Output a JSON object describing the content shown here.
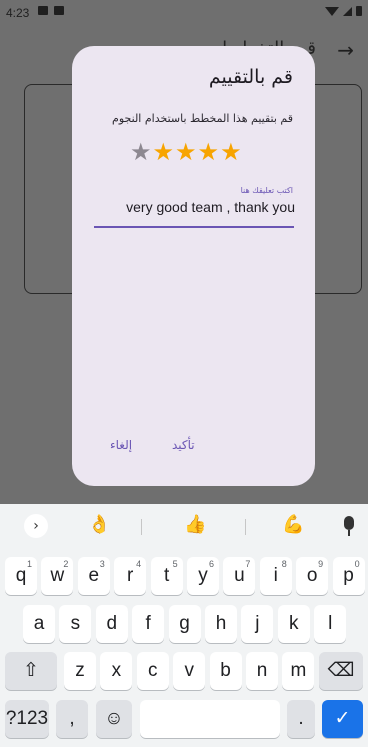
{
  "status": {
    "time": "4:23"
  },
  "background": {
    "title": "قم بالتخطيط",
    "back_arrow": "→"
  },
  "dialog": {
    "title": "قم بالتقييم",
    "subtitle": "قم بتقييم هذا المخطط باستخدام النجوم",
    "rating": {
      "value": 4,
      "max": 5,
      "on_color": "#f7a400",
      "off_color": "#8d8891"
    },
    "comment_label": "اكتب تعليقك هنا",
    "comment_value": "very good team  , thank you",
    "confirm_label": "تأكيد",
    "cancel_label": "إلغاء"
  },
  "keyboard": {
    "suggest_chevron": "›",
    "suggest_emojis": [
      "👌",
      "👍",
      "💪"
    ],
    "row1": [
      {
        "k": "q",
        "n": "1"
      },
      {
        "k": "w",
        "n": "2"
      },
      {
        "k": "e",
        "n": "3"
      },
      {
        "k": "r",
        "n": "4"
      },
      {
        "k": "t",
        "n": "5"
      },
      {
        "k": "y",
        "n": "6"
      },
      {
        "k": "u",
        "n": "7"
      },
      {
        "k": "i",
        "n": "8"
      },
      {
        "k": "o",
        "n": "9"
      },
      {
        "k": "p",
        "n": "0"
      }
    ],
    "row2": [
      "a",
      "s",
      "d",
      "f",
      "g",
      "h",
      "j",
      "k",
      "l"
    ],
    "row3": [
      "z",
      "x",
      "c",
      "v",
      "b",
      "n",
      "m"
    ],
    "shift": "⇧",
    "backspace": "⌫",
    "symbols": "?123",
    "comma": ",",
    "emoji": "☺",
    "period": ".",
    "enter": "✓"
  },
  "colors": {
    "accent": "#6a55b4",
    "keyboard_action": "#1a73e8"
  }
}
